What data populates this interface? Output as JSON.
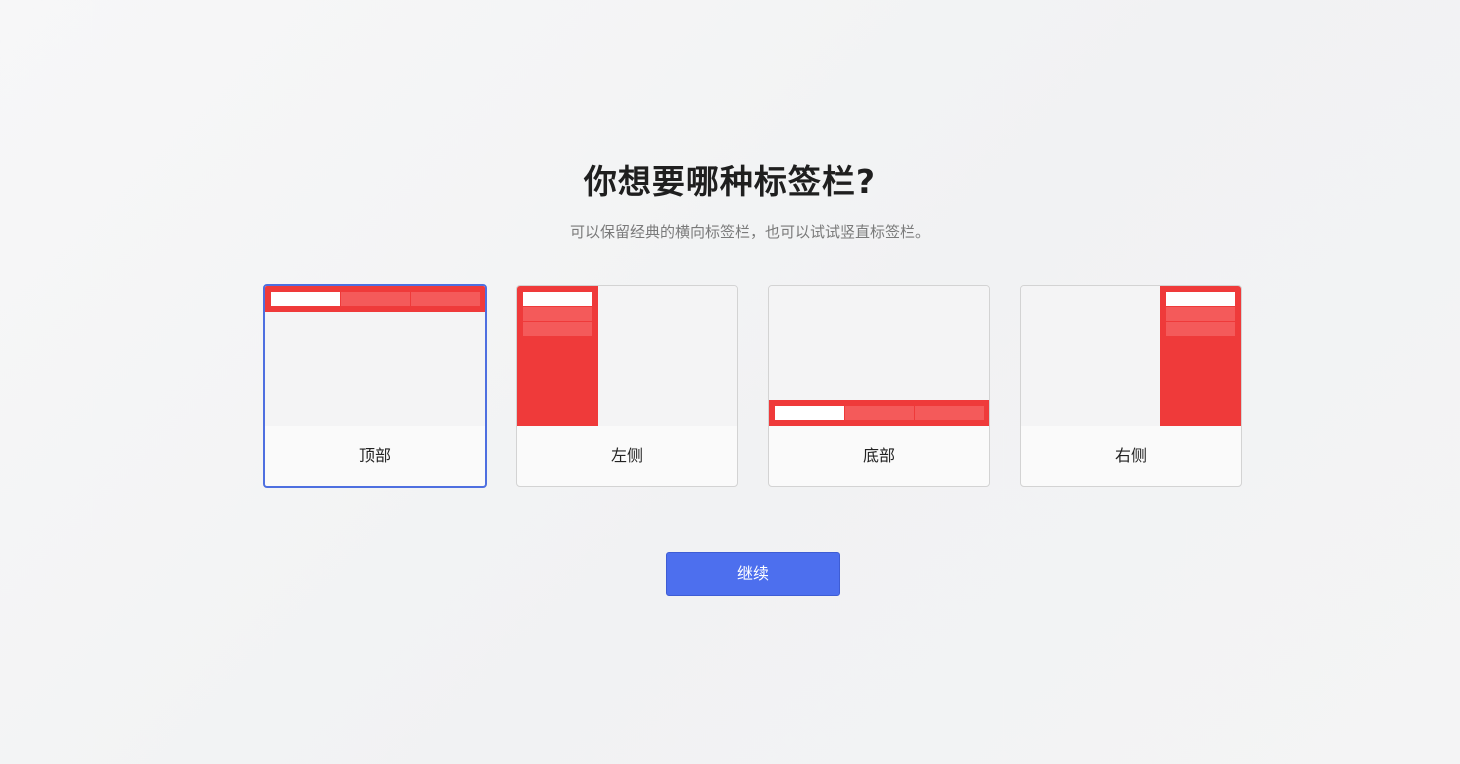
{
  "header": {
    "title": "你想要哪种标签栏?",
    "subtitle": "可以保留经典的横向标签栏，也可以试试竖直标签栏。"
  },
  "options": [
    {
      "label": "顶部",
      "selected": true
    },
    {
      "label": "左侧",
      "selected": false
    },
    {
      "label": "底部",
      "selected": false
    },
    {
      "label": "右侧",
      "selected": false
    }
  ],
  "actions": {
    "continue_label": "继续"
  },
  "colors": {
    "accent": "#4d6fee",
    "selected_border": "#4e6fe0",
    "tabbar": "#ef3a3a",
    "tab_inactive": "#f45a5a",
    "tab_active": "#ffffff"
  }
}
